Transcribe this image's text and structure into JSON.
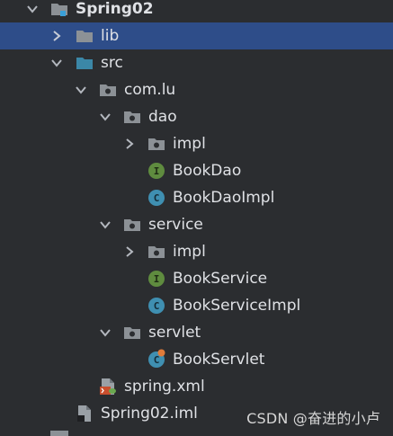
{
  "tree": {
    "project": "Spring02",
    "lib": "lib",
    "src": "src",
    "package": "com.lu",
    "dao": {
      "label": "dao",
      "impl": "impl",
      "interface": "BookDao",
      "class": "BookDaoImpl"
    },
    "service": {
      "label": "service",
      "impl": "impl",
      "interface": "BookService",
      "class": "BookServiceImpl"
    },
    "servlet": {
      "label": "servlet",
      "class": "BookServlet"
    },
    "xml_file": "spring.xml",
    "iml_file": "Spring02.iml"
  },
  "watermark": "CSDN @奋进的小卢",
  "colors": {
    "background": "#2b2d30",
    "selection": "#2e4d89",
    "folder": "#8c9196",
    "source_folder": "#3b87a7",
    "interface_icon": "#5f8c3f",
    "class_icon": "#3f8fb1"
  },
  "icons": {
    "expanded": "chevron-down-icon",
    "collapsed": "chevron-right-icon",
    "folder": "folder-icon",
    "package": "package-icon",
    "interface": "interface-icon",
    "class": "class-icon",
    "xml": "xml-file-icon",
    "iml": "iml-file-icon"
  }
}
